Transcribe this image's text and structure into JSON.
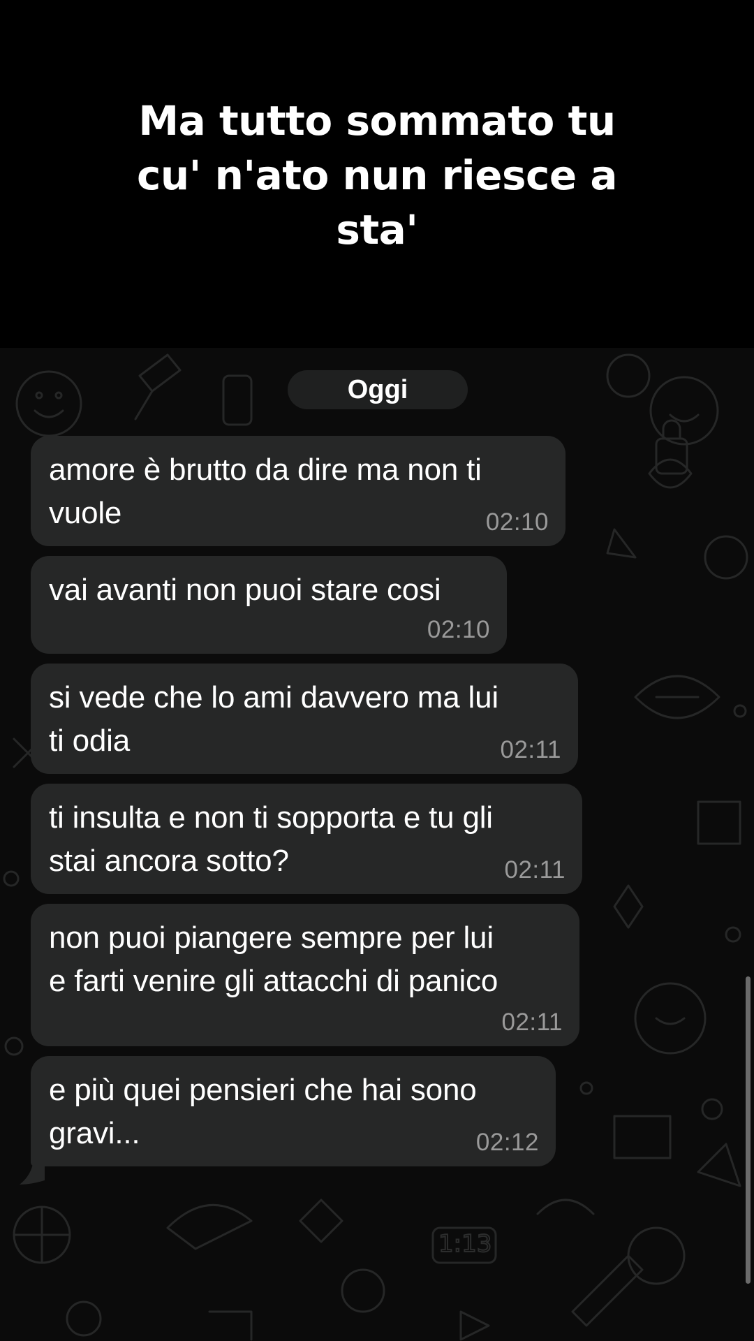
{
  "caption": {
    "line1": "Ma tutto sommato tu",
    "line2": "cu' n'ato nun riesce a",
    "line3": "sta'"
  },
  "chat": {
    "date_label": "Oggi",
    "messages": [
      {
        "text": "amore è brutto da dire ma non ti\nvuole",
        "time": "02:10"
      },
      {
        "text": "vai avanti non puoi stare cosi",
        "time": "02:10"
      },
      {
        "text": "si vede che lo ami davvero ma lui\nti odia",
        "time": "02:11"
      },
      {
        "text": "ti insulta e non ti sopporta e tu gli\nstai ancora sotto?",
        "time": "02:11"
      },
      {
        "text": "non puoi piangere sempre per lui\ne farti venire gli attacchi di panico",
        "time": "02:11"
      },
      {
        "text": "e più quei pensieri che hai sono\ngravi...",
        "time": "02:12"
      }
    ],
    "wallpaper_doodle": "1:13"
  },
  "colors": {
    "caption_bg": "#000000",
    "chat_bg": "#0b0b0b",
    "bubble_bg": "#262727",
    "date_pill_bg": "#1f2020",
    "time_text": "#9a9a9a"
  }
}
